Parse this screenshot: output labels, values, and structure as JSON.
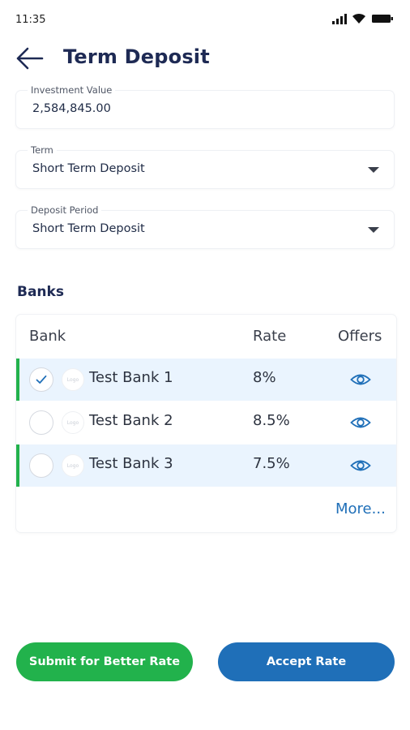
{
  "status_bar": {
    "time": "11:35",
    "icons": [
      "signal-icon",
      "wifi-icon",
      "battery-icon"
    ]
  },
  "header": {
    "title": "Term Deposit",
    "back_icon": "arrow-left-icon"
  },
  "form": {
    "investment": {
      "label": "Investment Value",
      "value": "2,584,845.00"
    },
    "term": {
      "label": "Term",
      "value": "Short Term Deposit"
    },
    "period": {
      "label": "Deposit Period",
      "value": "Short Term Deposit"
    }
  },
  "banks": {
    "title": "Banks",
    "columns": {
      "bank": "Bank",
      "rate": "Rate",
      "offers": "Offers"
    },
    "rows": [
      {
        "name": "Test Bank 1",
        "rate": "8%",
        "logo": "Logo",
        "checked": true,
        "highlighted": true
      },
      {
        "name": "Test Bank 2",
        "rate": "8.5%",
        "logo": "Logo",
        "checked": false,
        "highlighted": false
      },
      {
        "name": "Test Bank 3",
        "rate": "7.5%",
        "logo": "Logo",
        "checked": false,
        "highlighted": true
      }
    ],
    "more_label": "More..."
  },
  "actions": {
    "submit_label": "Submit for Better Rate",
    "accept_label": "Accept Rate"
  },
  "colors": {
    "primary": "#1f6fb8",
    "success": "#22b24c",
    "title": "#1e2a54",
    "row_highlight": "#eaf4fe"
  }
}
